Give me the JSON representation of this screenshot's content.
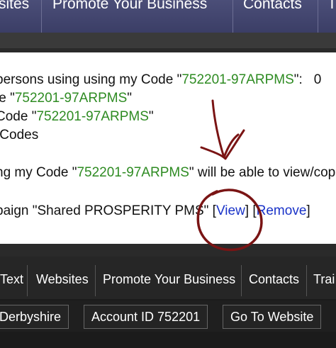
{
  "top_nav": {
    "items": [
      "sites",
      "Promote Your Business",
      "Contacts",
      "T"
    ]
  },
  "card": {
    "line1_prefix": "persons using using my Code \"",
    "line1_code": "752201-97ARPMS",
    "line1_suffix": "\":",
    "line1_count": "0",
    "line2_prefix": "le \"",
    "line2_code": "752201-97ARPMS",
    "line2_suffix": "\"",
    "line3_prefix": "Code \"",
    "line3_code": "752201-97ARPMS",
    "line3_suffix": "\"",
    "line4": "/Codes",
    "line5_prefix": "ng my Code \"",
    "line5_code": "752201-97ARPMS",
    "line5_suffix": "\" will be able to view/cop",
    "line6_prefix": "paign \"Shared PROSPERITY PMS\" [",
    "view_link": "View",
    "line6_mid": "] [",
    "remove_link": "Remove",
    "line6_suffix": "]"
  },
  "footer": {
    "nav_items": [
      "Text",
      "Websites",
      "Promote Your Business",
      "Contacts",
      "Trai"
    ],
    "location": "Derbyshire",
    "account_id": "Account ID 752201",
    "go_to_website": "Go To Website"
  },
  "colors": {
    "code_green": "#2e8b22",
    "link_blue": "#1a33c8",
    "annotation_red": "#7a1414",
    "top_nav_bg": "#3f4270"
  },
  "icons": {
    "annotation_arrow": "hand-drawn-arrow-icon",
    "annotation_circle": "hand-drawn-circle-icon"
  }
}
